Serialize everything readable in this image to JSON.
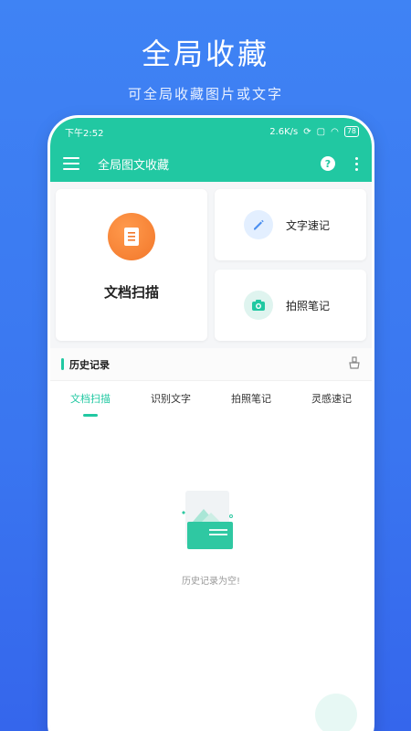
{
  "promo": {
    "title": "全局收藏",
    "subtitle": "可全局收藏图片或文字"
  },
  "status_bar": {
    "time": "下午2:52",
    "network_speed": "2.6K/s",
    "battery": "78"
  },
  "app_bar": {
    "title": "全局图文收藏",
    "help_label": "?"
  },
  "features": {
    "scan_label": "文档扫描",
    "text_note_label": "文字速记",
    "photo_note_label": "拍照笔记"
  },
  "history": {
    "title": "历史记录",
    "tabs": [
      {
        "label": "文档扫描",
        "active": true
      },
      {
        "label": "识别文字",
        "active": false
      },
      {
        "label": "拍照笔记",
        "active": false
      },
      {
        "label": "灵感速记",
        "active": false
      }
    ],
    "empty_message": "历史记录为空!"
  },
  "colors": {
    "primary": "#21c8a2",
    "background": "#3f83f4",
    "scan_icon": "#f2772a",
    "text_note_icon": "#4a8ef0"
  }
}
